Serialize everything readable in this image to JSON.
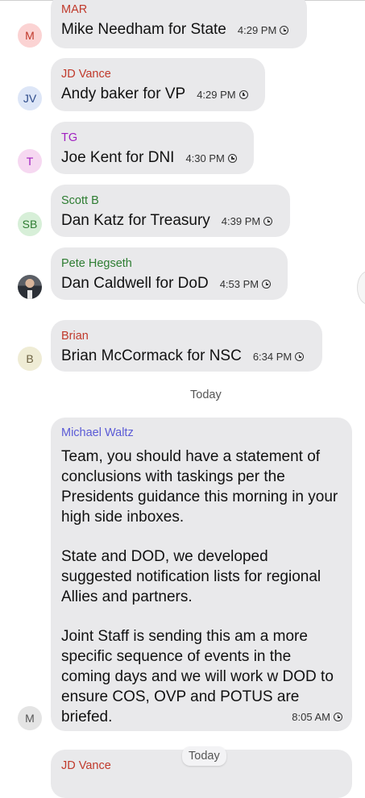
{
  "messages": [
    {
      "avatar": "M",
      "sender": "MAR",
      "text": "Mike Needham for State",
      "time": "4:29 PM"
    },
    {
      "avatar": "JV",
      "sender": "JD Vance",
      "text": "Andy baker for VP",
      "time": "4:29 PM"
    },
    {
      "avatar": "T",
      "sender": "TG",
      "text": "Joe Kent for DNI",
      "time": "4:30 PM"
    },
    {
      "avatar": "SB",
      "sender": "Scott B",
      "text": "Dan Katz for Treasury",
      "time": "4:39 PM"
    },
    {
      "avatar": "",
      "sender": "Pete Hegseth",
      "text": "Dan Caldwell for DoD",
      "time": "4:53 PM"
    },
    {
      "avatar": "B",
      "sender": "Brian",
      "text": "Brian McCormack for NSC",
      "time": "6:34 PM"
    }
  ],
  "day_separator": "Today",
  "long_message": {
    "avatar": "M",
    "sender": "Michael Waltz",
    "paragraphs": [
      "Team, you should have a statement of conclusions with taskings per the Presidents guidance this morning in your high side inboxes.",
      "State and DOD, we developed suggested notification lists for regional Allies and partners.",
      "Joint Staff is sending this am a more specific sequence of events in the coming days and we will work w DOD to ensure COS, OVP and POTUS are briefed."
    ],
    "time": "8:05 AM"
  },
  "next_message": {
    "sender": "JD Vance",
    "pill": "Today"
  },
  "colors": {
    "bubble": "#e9e9eb",
    "mar": "#c0392b",
    "jdvance": "#c0392b",
    "tg": "#a020c0",
    "scottb": "#2e7d32",
    "pete": "#2e7d32",
    "brian": "#c0392b",
    "waltz": "#5b5bd6"
  }
}
